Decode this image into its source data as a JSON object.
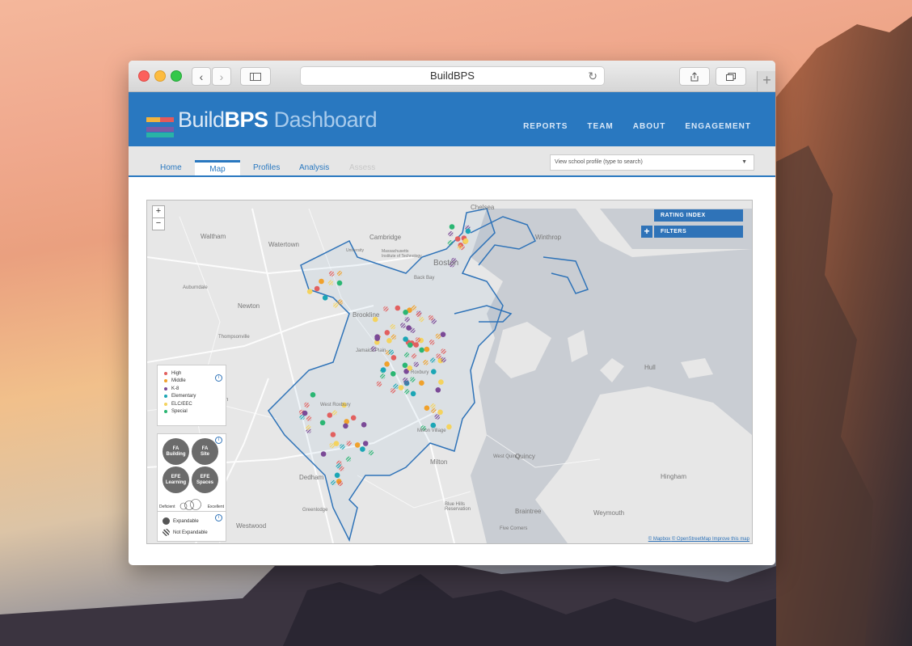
{
  "browser": {
    "url_text": "BuildBPS"
  },
  "app": {
    "logo_prefix": "Build",
    "logo_bold": "BPS",
    "logo_suffix": "Dashboard",
    "nav": [
      "REPORTS",
      "TEAM",
      "ABOUT",
      "ENGAGEMENT"
    ]
  },
  "tabs": [
    {
      "label": "Home"
    },
    {
      "label": "Map",
      "active": true
    },
    {
      "label": "Profiles"
    },
    {
      "label": "Analysis"
    },
    {
      "label": "Assess"
    }
  ],
  "school_search": {
    "placeholder": "View school profile (type to search)"
  },
  "map": {
    "zoom_in": "+",
    "zoom_out": "−",
    "rating_index_label": "RATING INDEX",
    "filters_label": "FILTERS",
    "filters_plus": "+",
    "attribution": [
      "© Mapbox",
      "© OpenStreetMap",
      "Improve this map"
    ],
    "place_labels": [
      "Chelsea",
      "Waltham",
      "Watertown",
      "Cambridge",
      "Winthrop",
      "Boston",
      "Auburndale",
      "Newton",
      "Brookline",
      "Thompsonville",
      "Needham",
      "Hull",
      "Milton",
      "Quincy",
      "Dedham",
      "Braintree",
      "Weymouth",
      "Hingham",
      "Westwood",
      "Blue Hills Reservation",
      "West Quincy",
      "Milton Village",
      "Five Corners",
      "Greenlodge",
      "University",
      "Massachusetts Institute of Technology",
      "Jamaica Plain",
      "West Roxbury",
      "Roxbury",
      "Back Bay"
    ]
  },
  "legend": {
    "types": [
      {
        "label": "High",
        "color": "#e2605f"
      },
      {
        "label": "Middle",
        "color": "#f0a12b"
      },
      {
        "label": "K-8",
        "color": "#7b4a97"
      },
      {
        "label": "Elementary",
        "color": "#1ba6b5"
      },
      {
        "label": "ELC/EEC",
        "color": "#f4d35e"
      },
      {
        "label": "Special",
        "color": "#2bb673"
      }
    ],
    "info": "i",
    "quadrants": [
      {
        "line1": "FA",
        "line2": "Building"
      },
      {
        "line1": "FA",
        "line2": "Site"
      },
      {
        "line1": "EFE",
        "line2": "Learning"
      },
      {
        "line1": "EFE",
        "line2": "Spaces"
      }
    ],
    "scale_min": "Deficient",
    "scale_max": "Excellent",
    "expand": [
      {
        "label": "Expandable"
      },
      {
        "label": "Not Expandable"
      }
    ]
  },
  "colors": {
    "header_blue": "#2978c0",
    "button_blue": "#2f73b8",
    "water": "#c9cdd3",
    "land": "#e7e7e7"
  }
}
